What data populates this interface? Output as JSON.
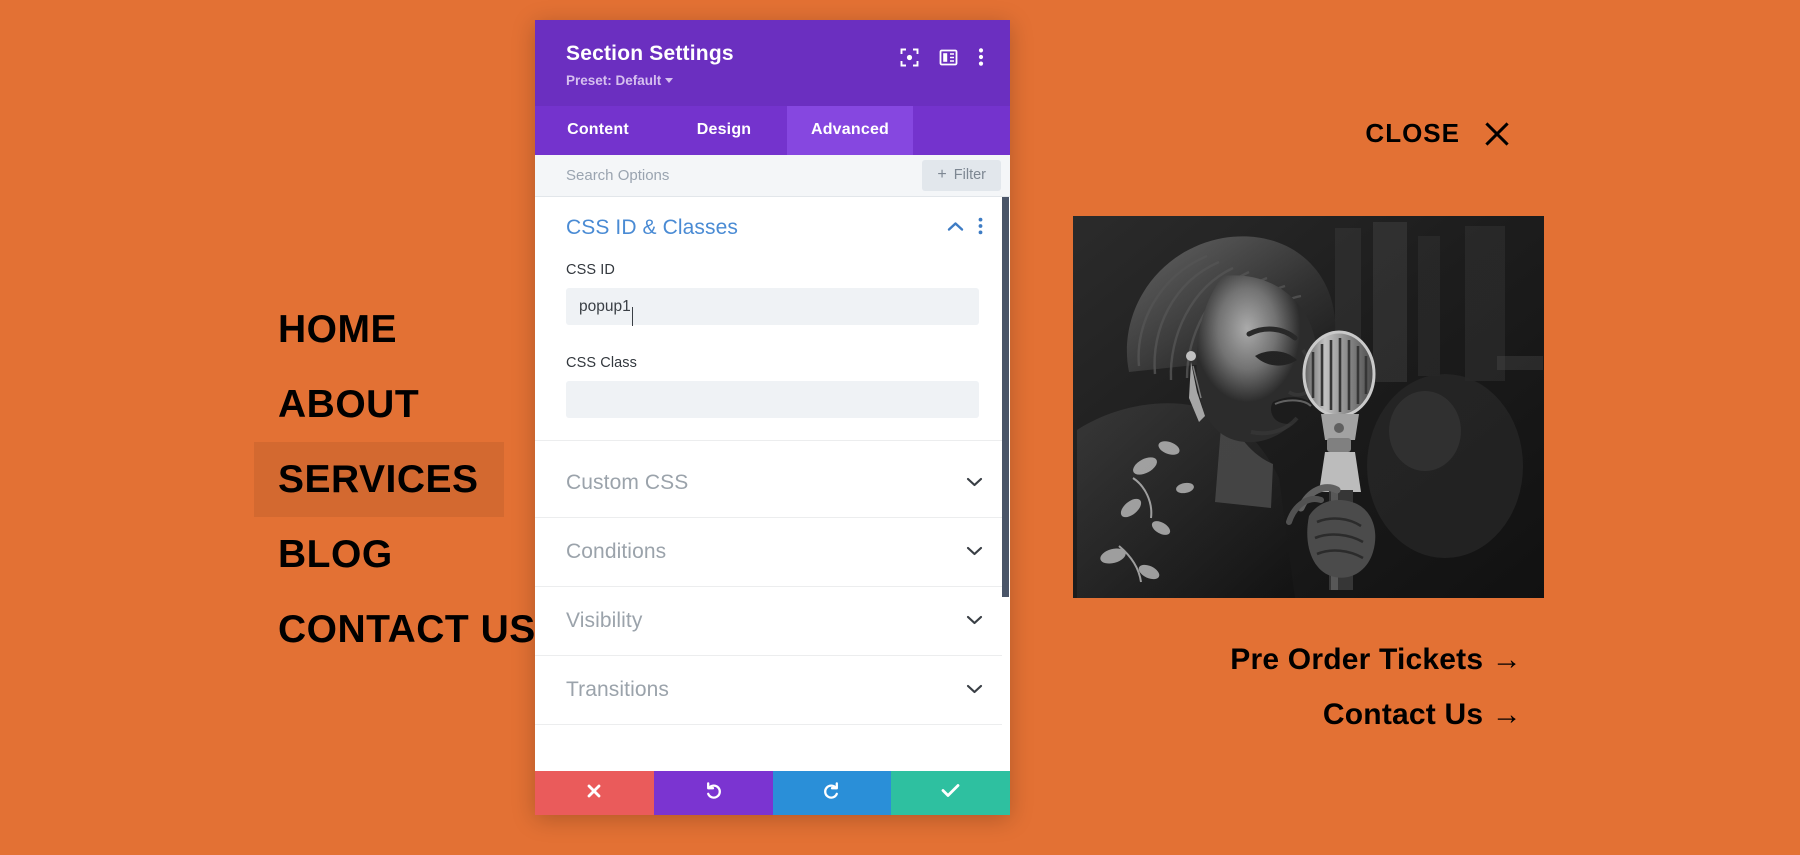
{
  "theme": {
    "page_background": "#e37134",
    "modal_header_purple": "#6b2fc0",
    "modal_tabbar_purple": "#7433cd",
    "modal_tab_active_purple": "#8647e0",
    "section_title_blue": "#4a8bd4",
    "section_title_grey": "#9ba3ab",
    "footer_cancel_red": "#ea5b5b",
    "footer_undo_purple": "#7b34d1",
    "footer_redo_blue": "#2a8fd8",
    "footer_save_green": "#2ec0a0",
    "scrollbar_thumb": "#4a5568"
  },
  "page": {
    "nav": {
      "items": [
        {
          "label": "HOME",
          "active": false
        },
        {
          "label": "ABOUT",
          "active": false
        },
        {
          "label": "SERVICES",
          "active": true
        },
        {
          "label": "BLOG",
          "active": false
        },
        {
          "label": "CONTACT US",
          "active": false
        }
      ]
    },
    "close": {
      "label": "CLOSE",
      "icon": "close-x-icon"
    },
    "hero": {
      "alt": "black and white photo of a woman singing into a vintage microphone"
    },
    "cta_links": [
      {
        "label": "Pre Order Tickets →"
      },
      {
        "label": "Contact Us →"
      }
    ]
  },
  "modal": {
    "title": "Section Settings",
    "preset_label": "Preset: Default",
    "header_icons": [
      {
        "name": "focus-target-icon"
      },
      {
        "name": "layout-panel-icon"
      },
      {
        "name": "more-vertical-icon"
      }
    ],
    "tabs": [
      {
        "label": "Content",
        "active": false
      },
      {
        "label": "Design",
        "active": false
      },
      {
        "label": "Advanced",
        "active": true
      }
    ],
    "search": {
      "placeholder": "Search Options",
      "value": ""
    },
    "filter_button": {
      "label": "Filter",
      "plus": "+"
    },
    "open_section": {
      "title": "CSS ID & Classes",
      "chevron": "chevron-up-icon",
      "menu": "more-vertical-icon",
      "fields": [
        {
          "label": "CSS ID",
          "value": "popup1",
          "placeholder": "",
          "focused": true
        },
        {
          "label": "CSS Class",
          "value": "",
          "placeholder": "",
          "focused": false
        }
      ]
    },
    "collapsed_sections": [
      {
        "title": "Custom CSS",
        "chevron": "chevron-down-icon"
      },
      {
        "title": "Conditions",
        "chevron": "chevron-down-icon"
      },
      {
        "title": "Visibility",
        "chevron": "chevron-down-icon"
      },
      {
        "title": "Transitions",
        "chevron": "chevron-down-icon"
      }
    ],
    "footer_buttons": [
      {
        "name": "cancel-button",
        "icon": "x-icon"
      },
      {
        "name": "undo-button",
        "icon": "undo-arrow-icon"
      },
      {
        "name": "redo-button",
        "icon": "redo-arrow-icon"
      },
      {
        "name": "save-button",
        "icon": "check-icon"
      }
    ]
  }
}
